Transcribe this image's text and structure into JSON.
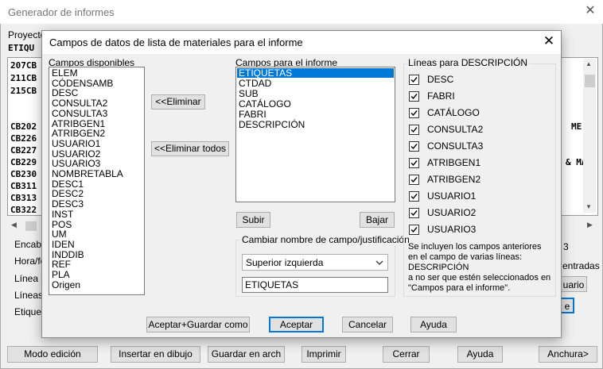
{
  "background": {
    "window_title": "Generador de informes",
    "proyecto_label": "Proyecto",
    "etiquetas_label": "ETIQU",
    "rows_top": [
      "207CB",
      "211CB",
      "215CB"
    ],
    "rows_bottom": [
      "CB202",
      "CB226",
      "CB227",
      "CB229",
      "CB230",
      "CB311",
      "CB313",
      "CB322"
    ],
    "right_frag_1": "ME",
    "right_frag_2": "& MA",
    "labels": {
      "encabezado": "Encabe",
      "hora": "Hora/fe",
      "linea": "Línea d",
      "lineas": "Líneas",
      "etiqueta": "Etiqueta",
      "frag_3": "3",
      "entradas": "entradas",
      "uario": "uario",
      "e": "e"
    },
    "buttons": {
      "modo": "Modo edición",
      "insertar": "Insertar en dibujo",
      "guardar": "Guardar en arch",
      "imprimir": "Imprimir",
      "cerrar": "Cerrar",
      "ayuda": "Ayuda",
      "anchura": "Anchura>"
    }
  },
  "dialog": {
    "title": "Campos de datos de lista de materiales para el informe",
    "available_label": "Campos disponibles",
    "available_fields": [
      "ELEM",
      "CÓDENSAMB",
      "DESC",
      "CONSULTA2",
      "CONSULTA3",
      "ATRIBGEN1",
      "ATRIBGEN2",
      "USUARIO1",
      "USUARIO2",
      "USUARIO3",
      "NOMBRETABLA",
      "DESC1",
      "DESC2",
      "DESC3",
      "INST",
      "POS",
      "UM",
      "IDEN",
      "INDDIB",
      "REF",
      "PLA",
      "Origen"
    ],
    "remove_button": "<<Eliminar",
    "remove_all_button": "<<Eliminar todos",
    "report_label": "Campos para el informe",
    "report_fields": [
      "ETIQUETAS",
      "CTDAD",
      "SUB",
      "CATÁLOGO",
      "FABRI",
      "DESCRIPCIÓN"
    ],
    "selected_report_field": "ETIQUETAS",
    "up_button": "Subir",
    "down_button": "Bajar",
    "rename_group_label": "Cambiar nombre de campo/justificación",
    "justification_value": "Superior izquierda",
    "rename_value": "ETIQUETAS",
    "lines_group_label": "Líneas para DESCRIPCIÓN",
    "lines": [
      {
        "label": "DESC",
        "checked": true
      },
      {
        "label": "FABRI",
        "checked": true
      },
      {
        "label": "CATÁLOGO",
        "checked": true
      },
      {
        "label": "CONSULTA2",
        "checked": true
      },
      {
        "label": "CONSULTA3",
        "checked": true
      },
      {
        "label": "ATRIBGEN1",
        "checked": true
      },
      {
        "label": "ATRIBGEN2",
        "checked": true
      },
      {
        "label": "USUARIO1",
        "checked": true
      },
      {
        "label": "USUARIO2",
        "checked": true
      },
      {
        "label": "USUARIO3",
        "checked": true
      }
    ],
    "note_lines": [
      "Se incluyen los campos anteriores",
      "en el campo de varias líneas:",
      "DESCRIPCIÓN",
      "a no ser que estén seleccionados en",
      "\"Campos para el informe\"."
    ],
    "buttons": {
      "accept_save": "Aceptar+Guardar como",
      "accept": "Aceptar",
      "cancel": "Cancelar",
      "help": "Ayuda"
    }
  },
  "colors": {
    "selection": "#0078d7",
    "button_face": "#e1e1e1",
    "dialog_bg": "#f0f0f0"
  }
}
